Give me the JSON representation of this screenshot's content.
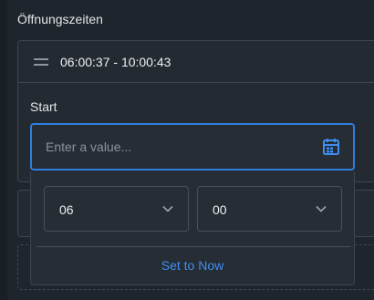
{
  "section": {
    "label": "Öffnungszeiten"
  },
  "range_item": {
    "value": "06:00:37 - 10:00:43"
  },
  "start_field": {
    "label": "Start",
    "placeholder": "Enter a value..."
  },
  "time_picker": {
    "hours": "06",
    "minutes": "00",
    "set_now_label": "Set to Now"
  },
  "icons": {
    "drag": "drag-handle-icon",
    "calendar": "calendar-icon",
    "chevron": "chevron-down-icon"
  },
  "colors": {
    "background": "#1f252c",
    "accent": "#2f7fe0",
    "link": "#3f8ef0",
    "border": "#3c4651"
  }
}
